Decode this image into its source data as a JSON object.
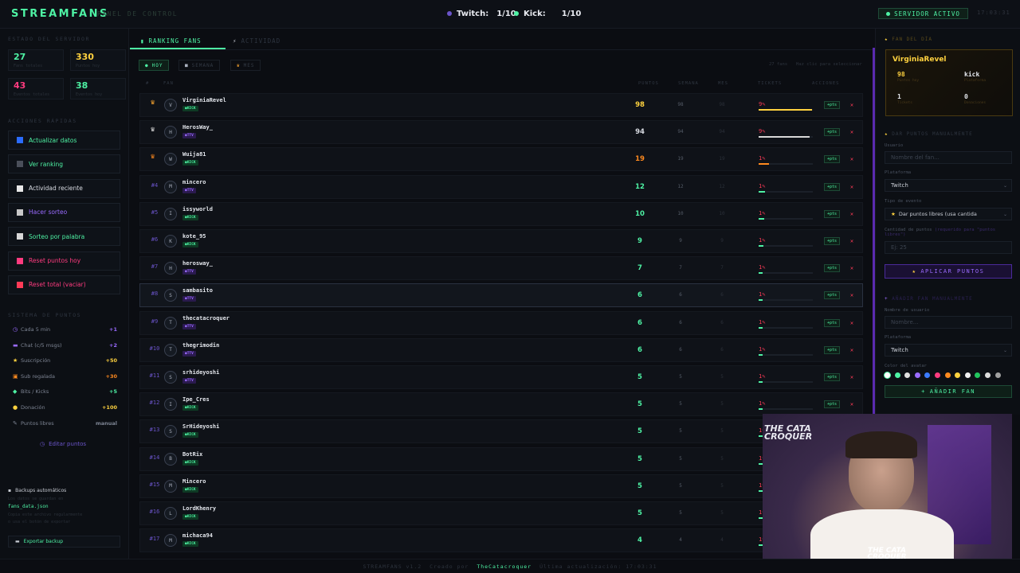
{
  "header": {
    "logo": "STREAMFANS",
    "subtitle": "PANEL DE CONTROL",
    "twitch_label": "Twitch:",
    "twitch_count": "1/10",
    "kick_label": "Kick:",
    "kick_count": "1/10",
    "server_status": "SERVIDOR ACTIVO",
    "clock": "17:03:31"
  },
  "left": {
    "stats_title": "ESTADO DEL SERVIDOR",
    "stats": [
      {
        "value": "27",
        "label": "Fans totales",
        "color": "#4ef2a4"
      },
      {
        "value": "330",
        "label": "Puntos hoy",
        "color": "#ffd23f"
      },
      {
        "value": "43",
        "label": "Eventos totales",
        "color": "#ff3b7f"
      },
      {
        "value": "38",
        "label": "Eventos hoy",
        "color": "#4ef2a4"
      }
    ],
    "actions_title": "ACCIONES RÁPIDAS",
    "actions": [
      {
        "label": "Actualizar datos",
        "color": "#4ef2a4",
        "icon": "refresh-icon",
        "ic": "#2b6cff"
      },
      {
        "label": "Ver ranking",
        "color": "#4ef2a4",
        "icon": "ranking-icon",
        "ic": "#4a4f5a"
      },
      {
        "label": "Actividad reciente",
        "color": "#d8dbe2",
        "icon": "lightning-icon",
        "ic": "#e8e8e8"
      },
      {
        "label": "Hacer sorteo",
        "color": "#9a6bff",
        "icon": "dice-icon",
        "ic": "#c8c8c8"
      },
      {
        "label": "Sorteo por palabra",
        "color": "#4ef2a4",
        "icon": "chat-icon",
        "ic": "#d8d8d8"
      },
      {
        "label": "Reset puntos hoy",
        "color": "#ff3b7f",
        "icon": "reset-icon",
        "ic": "#ff3b7f"
      },
      {
        "label": "Reset total (vaciar)",
        "color": "#ff3b7f",
        "icon": "warning-icon",
        "ic": "#ff3b57"
      }
    ],
    "points_title": "SISTEMA DE PUNTOS",
    "points": [
      {
        "icon": "◷",
        "label": "Cada 5 min",
        "value": "+1",
        "color": "#9a6bff"
      },
      {
        "icon": "▬",
        "label": "Chat (c/5 msgs)",
        "value": "+2",
        "color": "#9a6bff"
      },
      {
        "icon": "★",
        "label": "Suscripción",
        "value": "+50",
        "color": "#ffd23f"
      },
      {
        "icon": "▣",
        "label": "Sub regalada",
        "value": "+30",
        "color": "#ff8a1f"
      },
      {
        "icon": "◆",
        "label": "Bits / Kicks",
        "value": "+5",
        "color": "#4ef2a4"
      },
      {
        "icon": "●",
        "label": "Donación",
        "value": "+100",
        "color": "#ffd23f"
      },
      {
        "icon": "✎",
        "label": "Puntos libres",
        "value": "manual",
        "color": "#7d8493"
      }
    ],
    "edit_points": "Editar puntos",
    "backup_title": "Backups automáticos",
    "backup_line1": "Los datos se guardan en",
    "backup_file": "fans_data.json",
    "backup_line2": "Copia este archivo regularmente",
    "backup_line3": "o usa el botón de exportar",
    "export_label": "Exportar backup"
  },
  "main": {
    "tabs": [
      {
        "label": "RANKING FANS"
      },
      {
        "label": "ACTIVIDAD"
      }
    ],
    "filters": [
      {
        "label": "HOY"
      },
      {
        "label": "SEMANA"
      },
      {
        "label": "MES"
      }
    ],
    "count_text": "27 fans",
    "hint": "Haz clic para seleccionar",
    "columns": {
      "rank": "#",
      "fan": "FAN",
      "points": "PUNTOS",
      "week": "SEMANA",
      "month": "MES",
      "ticket": "TICKETS",
      "actions": "ACCIONES"
    },
    "add_label": "+pts",
    "del_label": "✕",
    "rows": [
      {
        "rank": "1",
        "initial": "V",
        "name": "VirginiaRevel",
        "platform": "KICK",
        "points": "98",
        "week": "98",
        "month": "98",
        "tick": "9",
        "level": 0.98,
        "barcolor": "#ffd23f",
        "pcolor": "#ffd23f"
      },
      {
        "rank": "2",
        "initial": "H",
        "name": "HerosWay_",
        "platform": "TTV",
        "points": "94",
        "week": "94",
        "month": "94",
        "tick": "9",
        "level": 0.94,
        "barcolor": "#d8d8d8",
        "pcolor": "#d8dbe2"
      },
      {
        "rank": "3",
        "initial": "W",
        "name": "Wuija81",
        "platform": "KICK",
        "points": "19",
        "week": "19",
        "month": "19",
        "tick": "1",
        "level": 0.19,
        "barcolor": "#ff8a1f",
        "pcolor": "#ff8a1f"
      },
      {
        "rank": "#4",
        "initial": "M",
        "name": "mincero",
        "platform": "TTV",
        "points": "12",
        "week": "12",
        "month": "12",
        "tick": "1",
        "level": 0.12,
        "barcolor": "#4ef2a4",
        "pcolor": "#4ef2a4"
      },
      {
        "rank": "#5",
        "initial": "I",
        "name": "issyworld",
        "platform": "KICK",
        "points": "10",
        "week": "10",
        "month": "10",
        "tick": "1",
        "level": 0.1,
        "barcolor": "#4ef2a4",
        "pcolor": "#4ef2a4"
      },
      {
        "rank": "#6",
        "initial": "K",
        "name": "kote_95",
        "platform": "KICK",
        "points": "9",
        "week": "9",
        "month": "9",
        "tick": "1",
        "level": 0.09,
        "barcolor": "#4ef2a4",
        "pcolor": "#4ef2a4"
      },
      {
        "rank": "#7",
        "initial": "H",
        "name": "herosway_",
        "platform": "TTV",
        "points": "7",
        "week": "7",
        "month": "7",
        "tick": "1",
        "level": 0.07,
        "barcolor": "#4ef2a4",
        "pcolor": "#4ef2a4"
      },
      {
        "rank": "#8",
        "initial": "S",
        "name": "sambasito",
        "platform": "TTV",
        "points": "6",
        "week": "6",
        "month": "6",
        "tick": "1",
        "level": 0.06,
        "barcolor": "#4ef2a4",
        "pcolor": "#4ef2a4"
      },
      {
        "rank": "#9",
        "initial": "T",
        "name": "thecatacroquer",
        "platform": "TTV",
        "points": "6",
        "week": "6",
        "month": "6",
        "tick": "1",
        "level": 0.06,
        "barcolor": "#4ef2a4",
        "pcolor": "#4ef2a4"
      },
      {
        "rank": "#10",
        "initial": "T",
        "name": "thegrimodin",
        "platform": "TTV",
        "points": "6",
        "week": "6",
        "month": "6",
        "tick": "1",
        "level": 0.06,
        "barcolor": "#4ef2a4",
        "pcolor": "#4ef2a4"
      },
      {
        "rank": "#11",
        "initial": "S",
        "name": "srhideyoshi",
        "platform": "TTV",
        "points": "5",
        "week": "5",
        "month": "5",
        "tick": "1",
        "level": 0.05,
        "barcolor": "#4ef2a4",
        "pcolor": "#4ef2a4"
      },
      {
        "rank": "#12",
        "initial": "I",
        "name": "Ipe_Cres",
        "platform": "KICK",
        "points": "5",
        "week": "5",
        "month": "5",
        "tick": "1",
        "level": 0.05,
        "barcolor": "#4ef2a4",
        "pcolor": "#4ef2a4"
      },
      {
        "rank": "#13",
        "initial": "S",
        "name": "SrHideyoshi",
        "platform": "KICK",
        "points": "5",
        "week": "5",
        "month": "5",
        "tick": "1",
        "level": 0.05,
        "barcolor": "#4ef2a4",
        "pcolor": "#4ef2a4"
      },
      {
        "rank": "#14",
        "initial": "B",
        "name": "BotRix",
        "platform": "KICK",
        "points": "5",
        "week": "5",
        "month": "5",
        "tick": "1",
        "level": 0.05,
        "barcolor": "#4ef2a4",
        "pcolor": "#4ef2a4"
      },
      {
        "rank": "#15",
        "initial": "M",
        "name": "Mincero",
        "platform": "KICK",
        "points": "5",
        "week": "5",
        "month": "5",
        "tick": "1",
        "level": 0.05,
        "barcolor": "#4ef2a4",
        "pcolor": "#4ef2a4"
      },
      {
        "rank": "#16",
        "initial": "L",
        "name": "LordKhenry",
        "platform": "KICK",
        "points": "5",
        "week": "5",
        "month": "5",
        "tick": "1",
        "level": 0.05,
        "barcolor": "#4ef2a4",
        "pcolor": "#4ef2a4"
      },
      {
        "rank": "#17",
        "initial": "M",
        "name": "michaca94",
        "platform": "KICK",
        "points": "4",
        "week": "4",
        "month": "4",
        "tick": "1",
        "level": 0.04,
        "barcolor": "#4ef2a4",
        "pcolor": "#4ef2a4"
      }
    ]
  },
  "right": {
    "selected_title": "FAN DEL DÍA",
    "selected": {
      "name": "VirginiaRevel",
      "points": "98",
      "points_label": "Puntos hoy",
      "platform": "kick",
      "platform_label": "Plataforma",
      "tickets": "1",
      "tickets_label": "Tickets",
      "donations": "0",
      "donations_label": "Donaciones"
    },
    "manual_title": "DAR PUNTOS MANUALMENTE",
    "user_label": "Usuario",
    "user_placeholder": "Nombre del fan...",
    "platform_label": "Plataforma",
    "platform_value": "Twitch",
    "event_label": "Tipo de evento",
    "event_value": "Dar puntos libres (usa cantida",
    "amount_label": "Cantidad de puntos",
    "amount_hint": "(requerido para \"puntos libres\")",
    "amount_placeholder": "Ej: 25",
    "apply_label": "APLICAR PUNTOS",
    "addfan_title": "AÑADIR FAN MANUALMENTE",
    "name_label": "Nombre de usuario",
    "name_placeholder": "Nombre...",
    "platform2_label": "Plataforma",
    "platform2_value": "Twitch",
    "color_label": "Color del avatar",
    "colors": [
      "#ffffff",
      "#4ef2a4",
      "#e0e0e0",
      "#9a6bff",
      "#3b7bff",
      "#ff3b7f",
      "#ff8a1f",
      "#ffd23f",
      "#f0f0f0",
      "#22c55e",
      "#dcdcdc",
      "#a0a0a0"
    ],
    "addfan_btn": "AÑADIR FAN"
  },
  "cam": {
    "overlay": "THE CATA CROQUER",
    "overlay2": "THE CATA CROQUER"
  },
  "footer": {
    "version": "STREAMFANS v1.2",
    "made_by": "Creado por",
    "author": "TheCatacroquer",
    "updated": "Última actualización: 17:03:31"
  }
}
